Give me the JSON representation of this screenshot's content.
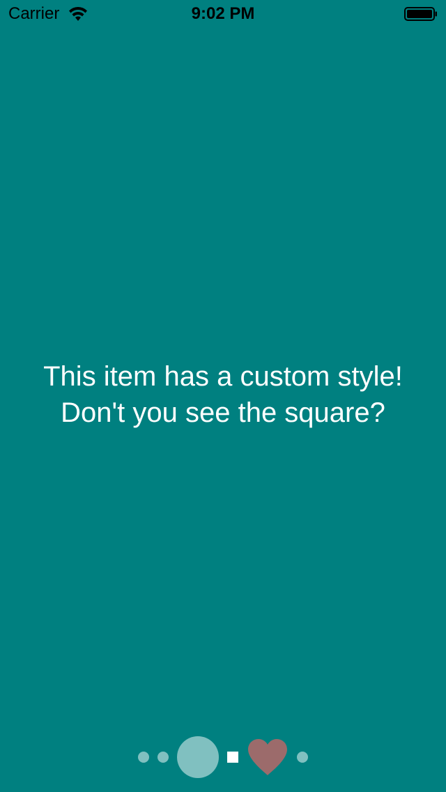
{
  "status_bar": {
    "carrier": "Carrier",
    "time": "9:02 PM",
    "icons": [
      "wifi-icon",
      "battery-icon"
    ]
  },
  "content": {
    "line1": "This item has a custom style!",
    "line2": "Don't you see the square?"
  },
  "page_control": {
    "page_count": 6,
    "current_page": 3,
    "indicator_styles": [
      "dot",
      "dot",
      "large-circle",
      "square",
      "heart",
      "dot"
    ]
  },
  "colors": {
    "background": "#008080",
    "dot": "#80c0c0",
    "square": "#ffffff",
    "heart": "#9c6b6b",
    "text": "#ffffff"
  }
}
